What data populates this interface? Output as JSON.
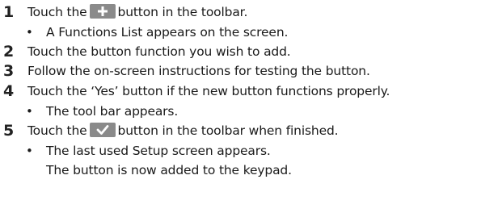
{
  "steps": [
    {
      "num": "1",
      "before": "Touch the",
      "icon": "plus-icon",
      "after": "button in the toolbar.",
      "bullets": [
        "A Functions List appears on the screen."
      ]
    },
    {
      "num": "2",
      "text": "Touch the button function you wish to add."
    },
    {
      "num": "3",
      "text": "Follow the on-screen instructions for testing the button."
    },
    {
      "num": "4",
      "text": "Touch the ‘Yes’ button if the new button functions properly.",
      "bullets": [
        "The tool bar appears."
      ]
    },
    {
      "num": "5",
      "before": "Touch the",
      "icon": "checkmark-icon",
      "after": "button in the toolbar when finished.",
      "bullets": [
        "The last used Setup screen appears."
      ],
      "continuation": "The button is now added to the keypad."
    }
  ]
}
